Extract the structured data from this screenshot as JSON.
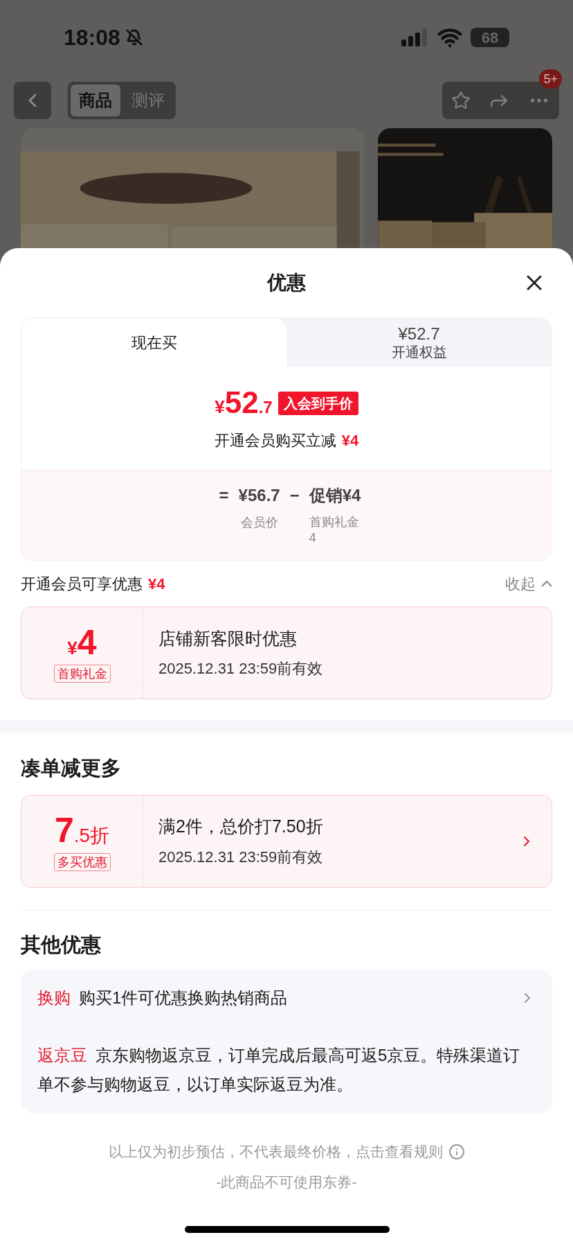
{
  "status_bar": {
    "time": "18:08",
    "battery": "68"
  },
  "nav": {
    "tabs": [
      {
        "label": "商品",
        "selected": true
      },
      {
        "label": "测评",
        "selected": false
      }
    ],
    "badge": "5+"
  },
  "sheet": {
    "title": "优惠",
    "price_tabs": [
      {
        "label": "现在买",
        "selected": true
      },
      {
        "price": "¥52.7",
        "label": "开通权益",
        "selected": false
      }
    ],
    "price": {
      "currency": "¥",
      "integer": "52",
      "decimal": ".7",
      "tag": "入会到手价",
      "note": "开通会员购买立减",
      "note_amount": "¥4"
    },
    "formula": {
      "equals": "=",
      "base": "¥56.7",
      "base_label": "会员价",
      "minus": "−",
      "discount": "促销¥4",
      "discount_label": "首购礼金",
      "discount_sub": "4"
    },
    "member": {
      "label": "开通会员可享优惠",
      "amount": "¥4",
      "collapse": "收起",
      "expanded": true,
      "coupons": [
        {
          "prefix": "¥",
          "value": "4",
          "tag": "首购礼金",
          "title": "店铺新客限时优惠",
          "validity": "2025.12.31 23:59前有效",
          "has_arrow": false
        }
      ]
    },
    "bundle": {
      "heading": "凑单减更多",
      "coupons": [
        {
          "value": "7",
          "suffix": ".5折",
          "tag": "多买优惠",
          "title": "满2件，总价打7.50折",
          "validity": "2025.12.31 23:59前有效",
          "has_arrow": true
        }
      ]
    },
    "others": {
      "heading": "其他优惠",
      "items": [
        {
          "label": "换购",
          "text": "购买1件可优惠换购热销商品",
          "has_arrow": true
        },
        {
          "label": "返京豆",
          "text": "京东购物返京豆，订单完成后最高可返5京豆。特殊渠道订单不参与购物返豆，以订单实际返豆为准。",
          "has_arrow": false
        }
      ]
    },
    "footer": {
      "note": "以上仅为初步预估，不代表最终价格，点击查看规则",
      "note2": "-此商品不可使用东券-"
    }
  }
}
